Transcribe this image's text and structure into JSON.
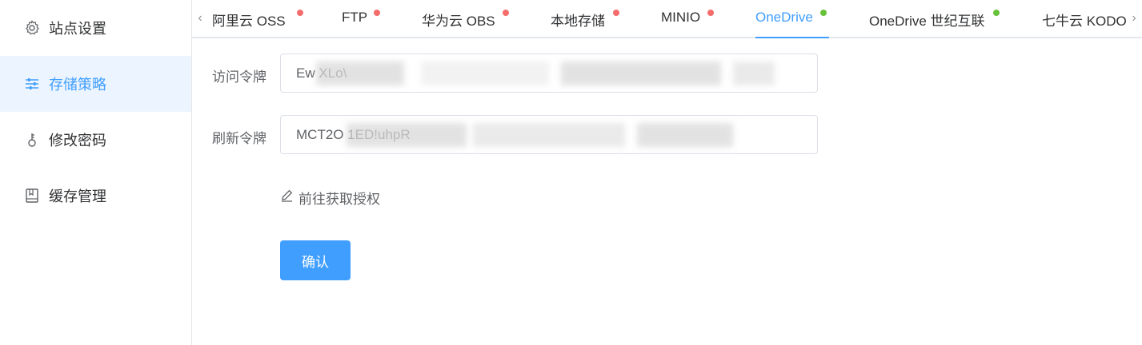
{
  "sidebar": {
    "items": [
      {
        "label": "站点设置",
        "icon": "gear-icon",
        "active": false
      },
      {
        "label": "存储策略",
        "icon": "sliders-icon",
        "active": true
      },
      {
        "label": "修改密码",
        "icon": "key-icon",
        "active": false
      },
      {
        "label": "缓存管理",
        "icon": "book-icon",
        "active": false
      }
    ]
  },
  "tabs": {
    "items": [
      {
        "label": "阿里云 OSS",
        "status": "red"
      },
      {
        "label": "FTP",
        "status": "red"
      },
      {
        "label": "华为云 OBS",
        "status": "red"
      },
      {
        "label": "本地存储",
        "status": "red"
      },
      {
        "label": "MINIO",
        "status": "red"
      },
      {
        "label": "OneDrive",
        "status": "green",
        "active": true
      },
      {
        "label": "OneDrive 世纪互联",
        "status": "green"
      },
      {
        "label": "七牛云 KODO",
        "status": "none"
      }
    ],
    "prev_arrow": "‹",
    "next_arrow": "›"
  },
  "form": {
    "access_token_label": "访问令牌",
    "access_token_value": "Ew                                                          XLo\\",
    "refresh_token_label": "刷新令牌",
    "refresh_token_value": "MCT2O                                                       1ED!uhpR",
    "auth_link_label": "前往获取授权",
    "confirm_label": "确认"
  },
  "colors": {
    "accent": "#409eff",
    "status_red": "#f56c6c",
    "status_green": "#67c23a",
    "active_bg": "#ecf5ff"
  }
}
